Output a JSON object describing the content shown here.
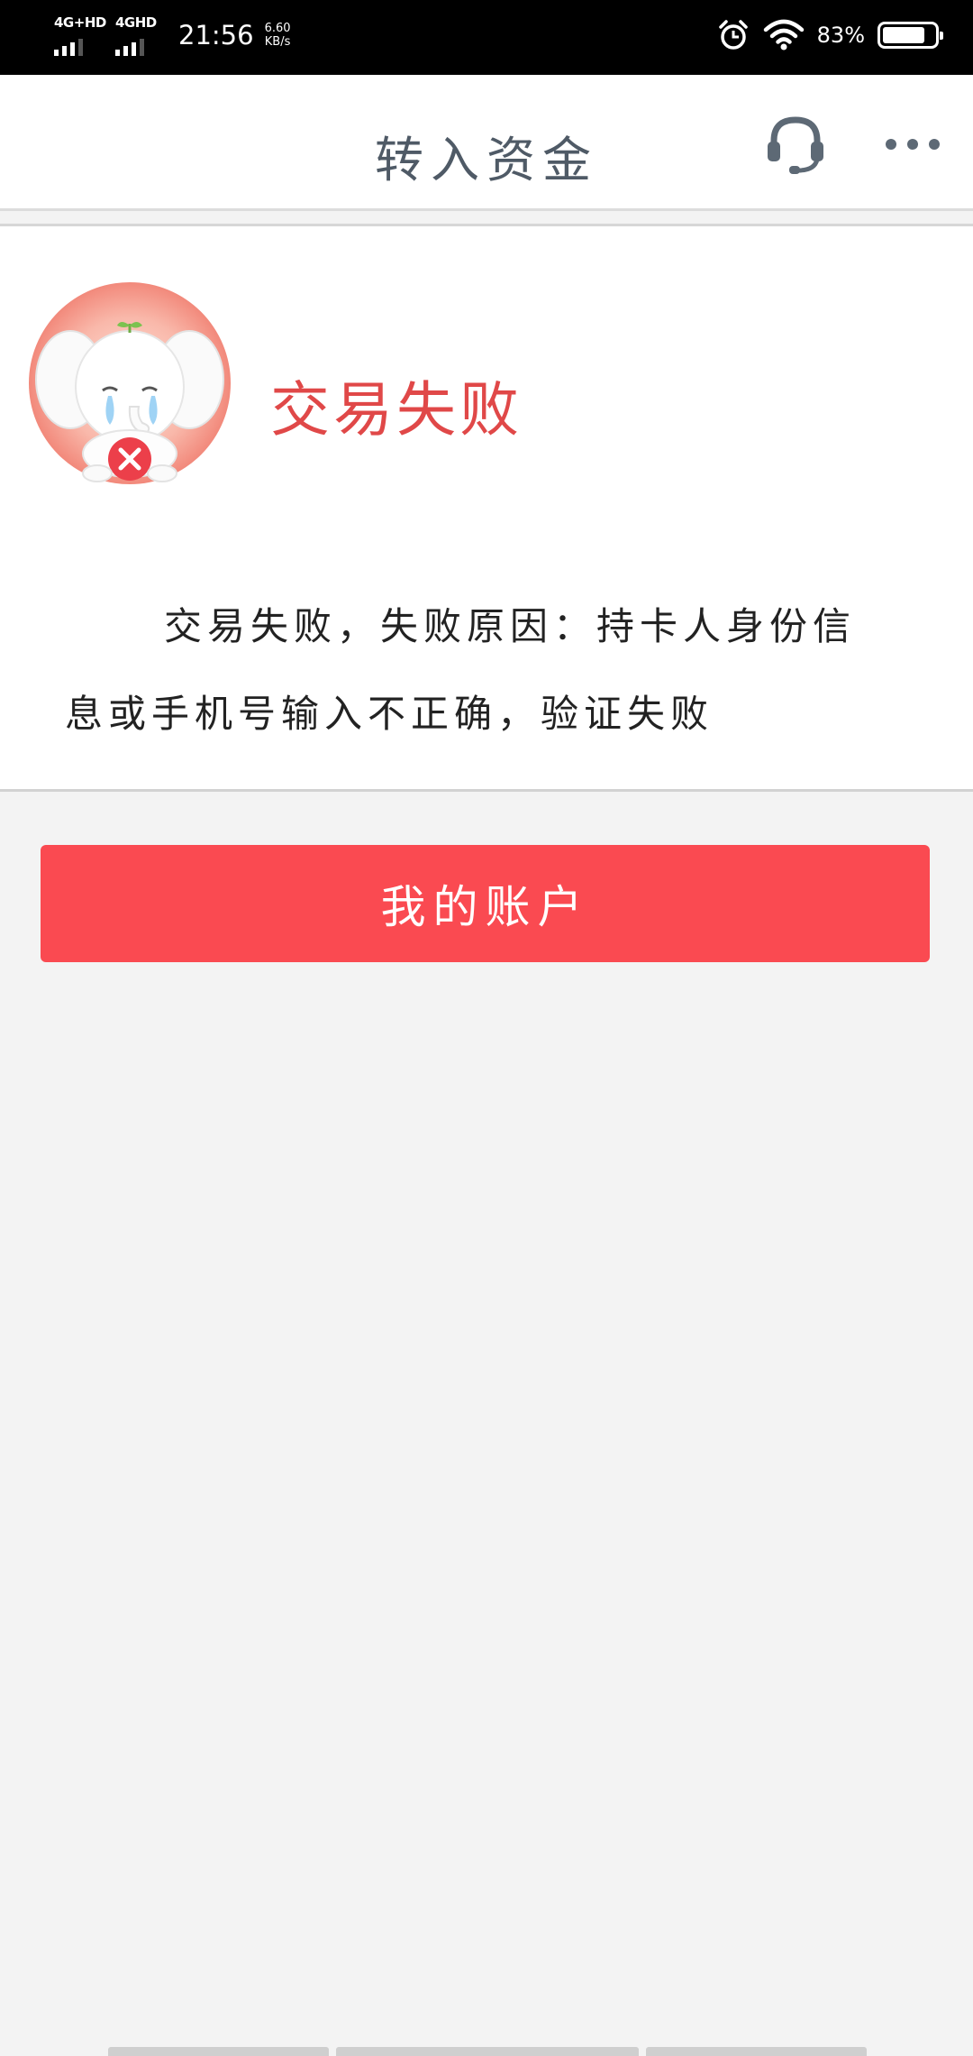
{
  "status_bar": {
    "network1": "4G+HD",
    "network2": "4GHD",
    "time": "21:56",
    "speed_value": "6.60",
    "speed_unit": "KB/s",
    "battery_percent": "83%",
    "battery_level": 0.83
  },
  "header": {
    "title": "转入资金",
    "support_icon": "headset-icon",
    "more_icon": "more-dots-icon",
    "title_color": "#4f5a66"
  },
  "result": {
    "title": "交易失败",
    "message": "交易失败，失败原因：持卡人身份信息或手机号输入不正确，验证失败",
    "title_color": "#e04848",
    "illustration_icon": "crying-elephant-icon"
  },
  "actions": {
    "my_account_label": "我的账户",
    "button_color": "#fa4a51"
  }
}
